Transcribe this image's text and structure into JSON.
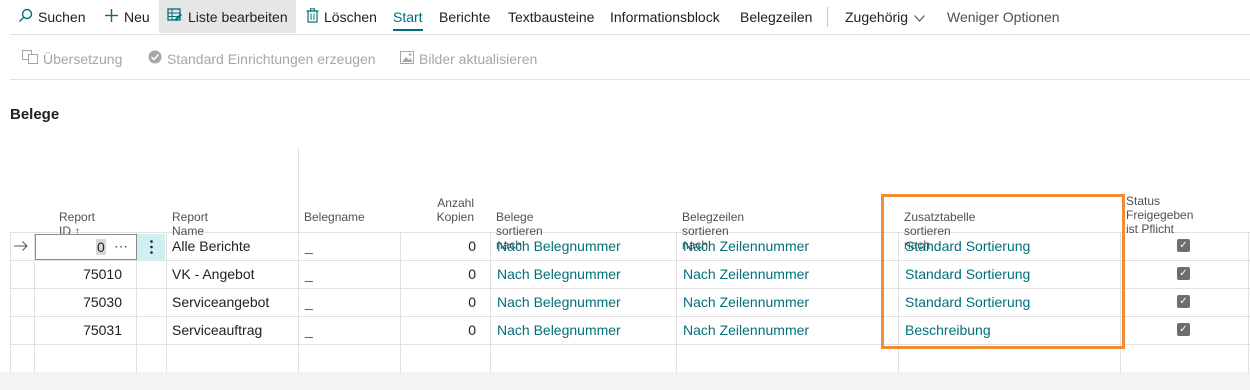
{
  "toolbar": {
    "search": "Suchen",
    "new": "Neu",
    "edit_list": "Liste bearbeiten",
    "delete": "Löschen",
    "tab_start": "Start",
    "tab_reports": "Berichte",
    "tab_textblocks": "Textbausteine",
    "tab_infoblock": "Informationsblock",
    "tab_doclines": "Belegzeilen",
    "related": "Zugehörig",
    "fewer_options": "Weniger Optionen"
  },
  "toolbar2": {
    "translation": "Übersetzung",
    "create_defaults": "Standard Einrichtungen erzeugen",
    "update_images": "Bilder aktualisieren"
  },
  "section": {
    "title": "Belege"
  },
  "table": {
    "headers": {
      "report_id": "Report ID ↑",
      "report_name": "Report Name",
      "doc_name": "Belegname",
      "copies_1": "Anzahl",
      "copies_2": "Kopien",
      "sort_docs": "Belege sortieren nach",
      "sort_lines": "Belegzeilen sortieren nach",
      "sort_extra": "Zusatztabelle sortieren nach",
      "status_1": "Status Freigegeben",
      "status_2": "ist Pflicht"
    },
    "rows": [
      {
        "report_id": "0",
        "report_name": "Alle Berichte",
        "doc_name": "_",
        "copies": "0",
        "sort_docs": "Nach Belegnummer",
        "sort_lines": "Nach Zeilennummer",
        "sort_extra": "Standard Sortierung",
        "status": true
      },
      {
        "report_id": "75010",
        "report_name": "VK - Angebot",
        "doc_name": "_",
        "copies": "0",
        "sort_docs": "Nach Belegnummer",
        "sort_lines": "Nach Zeilennummer",
        "sort_extra": "Standard Sortierung",
        "status": true
      },
      {
        "report_id": "75030",
        "report_name": "Serviceangebot",
        "doc_name": "_",
        "copies": "0",
        "sort_docs": "Nach Belegnummer",
        "sort_lines": "Nach Zeilennummer",
        "sort_extra": "Standard Sortierung",
        "status": true
      },
      {
        "report_id": "75031",
        "report_name": "Serviceauftrag",
        "doc_name": "_",
        "copies": "0",
        "sort_docs": "Nach Belegnummer",
        "sort_lines": "Nach Zeilennummer",
        "sort_extra": "Beschreibung",
        "status": true
      }
    ]
  },
  "colors": {
    "accent": "#00707a",
    "highlight": "#f08c32"
  }
}
